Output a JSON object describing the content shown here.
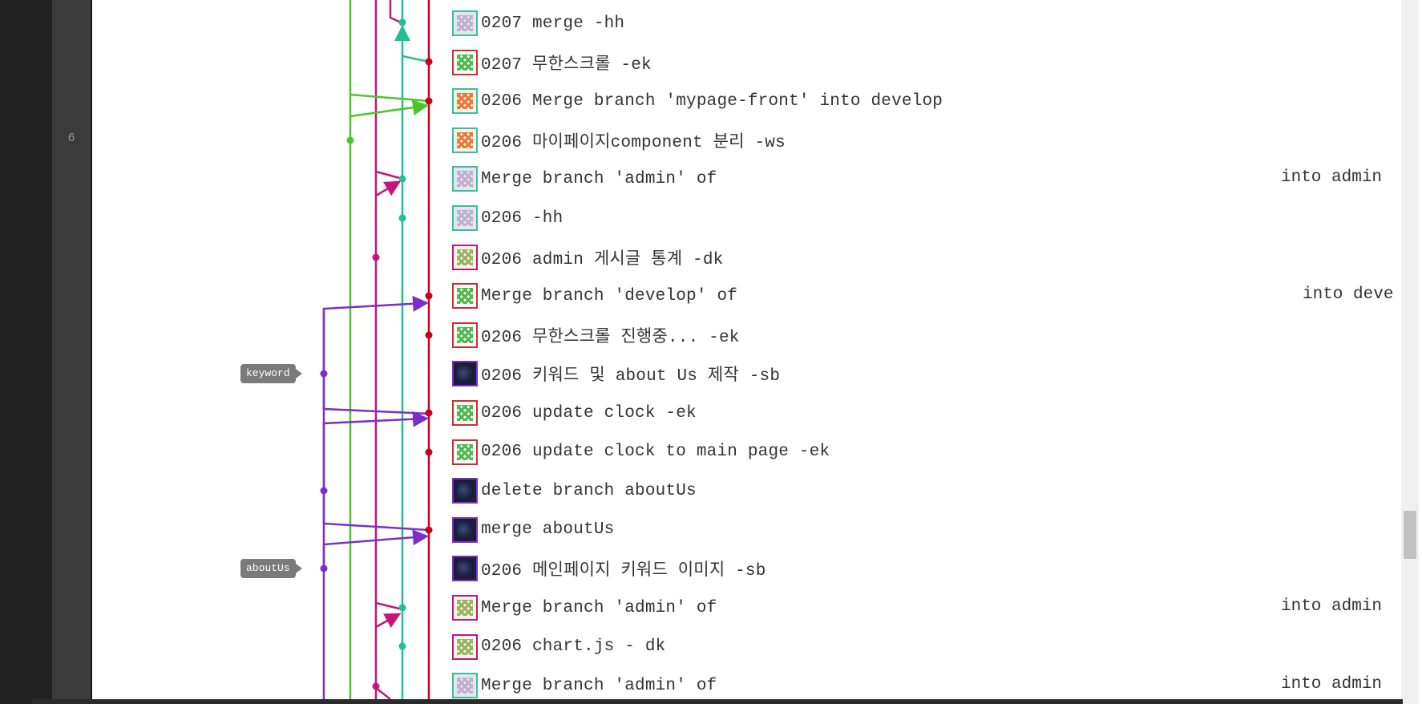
{
  "editor": {
    "line_number": "6"
  },
  "branch_tags": {
    "keyword": "keyword",
    "aboutus": "aboutUs"
  },
  "lane_colors": {
    "purple": "#7b2fc8",
    "green": "#4cc62e",
    "magenta": "#c5147a",
    "teal": "#1fc093",
    "red": "#c8001b"
  },
  "commits": [
    {
      "message": "0207 merge -hh",
      "suffix": "",
      "avatar": "identicon-gray"
    },
    {
      "message": "0207 무한스크롤 -ek",
      "suffix": "",
      "avatar": "identicon-green"
    },
    {
      "message": "0206 Merge branch 'mypage-front' into develop",
      "suffix": "",
      "avatar": "identicon-orange"
    },
    {
      "message": "0206 마이페이지component 분리 -ws",
      "suffix": "",
      "avatar": "identicon-orange"
    },
    {
      "message": "Merge branch 'admin' of",
      "suffix": "into admin",
      "avatar": "identicon-gray"
    },
    {
      "message": "0206 -hh",
      "suffix": "",
      "avatar": "identicon-gray"
    },
    {
      "message": "0206 admin 게시글 통계 -dk",
      "suffix": "",
      "avatar": "identicon-olive"
    },
    {
      "message": "Merge branch 'develop' of",
      "suffix": "into deve",
      "avatar": "identicon-green"
    },
    {
      "message": "0206 무한스크롤 진행중... -ek",
      "suffix": "",
      "avatar": "identicon-green"
    },
    {
      "message": "0206 키워드 및 about Us 제작 -sb",
      "suffix": "",
      "avatar": "photo-dark"
    },
    {
      "message": "0206 update clock -ek",
      "suffix": "",
      "avatar": "identicon-green"
    },
    {
      "message": "0206 update clock to main page -ek",
      "suffix": "",
      "avatar": "identicon-green"
    },
    {
      "message": "delete branch aboutUs",
      "suffix": "",
      "avatar": "photo-dark"
    },
    {
      "message": "merge aboutUs",
      "suffix": "",
      "avatar": "photo-dark"
    },
    {
      "message": "0206 메인페이지 키워드 이미지 -sb",
      "suffix": "",
      "avatar": "photo-dark"
    },
    {
      "message": "Merge branch 'admin' of",
      "suffix": "into admin",
      "avatar": "identicon-olive"
    },
    {
      "message": "0206 chart.js - dk",
      "suffix": "",
      "avatar": "identicon-olive"
    },
    {
      "message": "Merge branch 'admin' of",
      "suffix": "into admin",
      "avatar": "identicon-gray"
    }
  ]
}
